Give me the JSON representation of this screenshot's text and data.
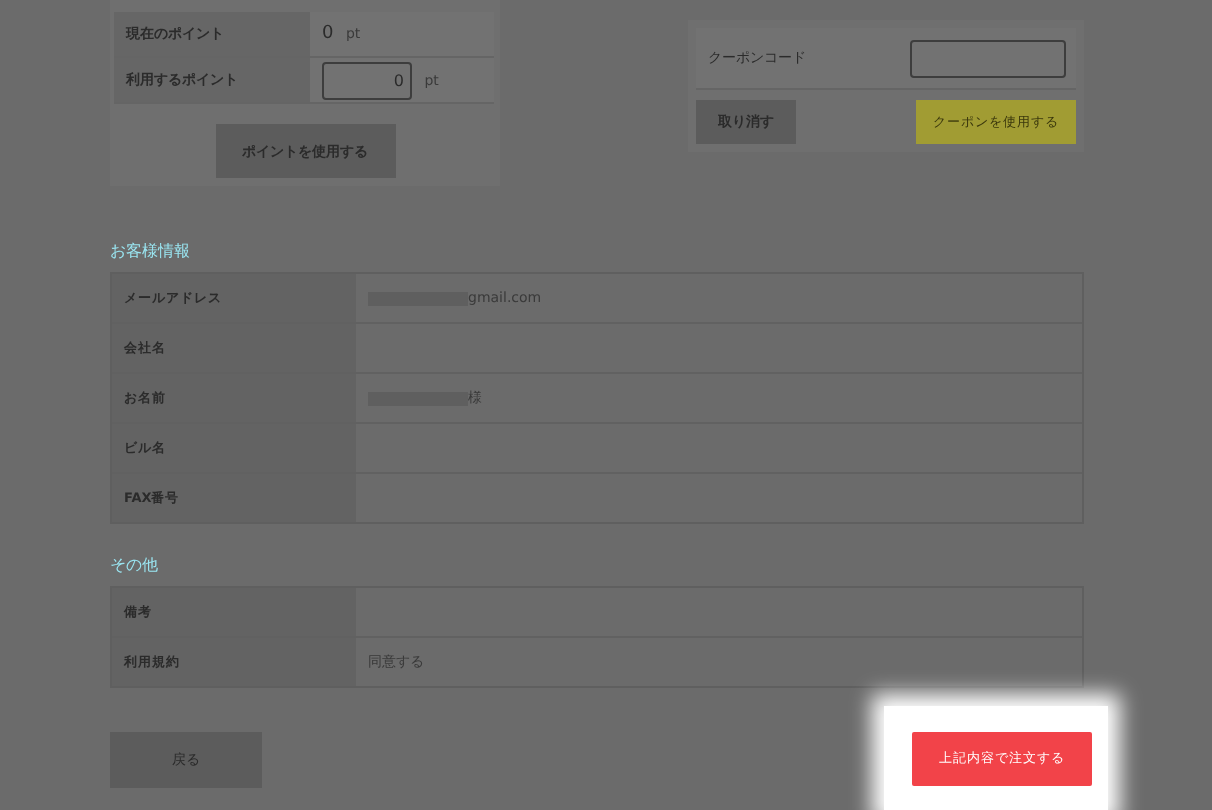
{
  "points": {
    "rows": [
      {
        "label": "現在のポイント",
        "value": "0",
        "unit": "pt",
        "kind": "text"
      },
      {
        "label": "利用するポイント",
        "value": "0",
        "unit": "pt",
        "kind": "input"
      }
    ],
    "button": "ポイントを使用する"
  },
  "coupon": {
    "label": "クーポンコード",
    "cancel_button": "取り消す",
    "apply_button": "クーポンを使用する"
  },
  "sections": [
    {
      "title": "お客様情報",
      "rows": [
        {
          "label": "メールアドレス",
          "value": "gmail.com",
          "masked": true
        },
        {
          "label": "会社名",
          "value": "",
          "masked": false
        },
        {
          "label": "お名前",
          "value": "様",
          "masked": true
        },
        {
          "label": "ビル名",
          "value": "",
          "masked": false
        },
        {
          "label": "FAX番号",
          "value": "",
          "masked": false
        }
      ]
    },
    {
      "title": "その他",
      "rows": [
        {
          "label": "備考",
          "value": "",
          "masked": false
        },
        {
          "label": "利用規約",
          "value": "同意する",
          "masked": false
        }
      ]
    }
  ],
  "back_button": "戻る",
  "order_button": "上記内容で注文する"
}
